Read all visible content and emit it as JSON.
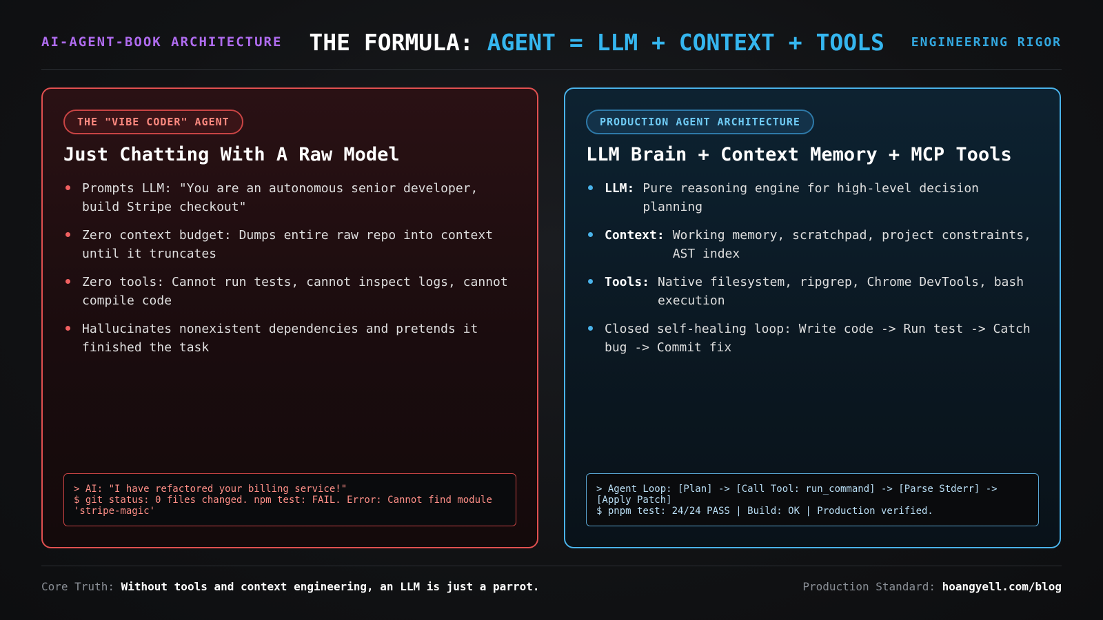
{
  "header": {
    "brand": "AI-AGENT-BOOK ARCHITECTURE",
    "formula_lead": "THE FORMULA:",
    "formula_accent": "AGENT = LLM + CONTEXT + TOOLS",
    "tag": "ENGINEERING RIGOR"
  },
  "left_card": {
    "badge": "THE \"VIBE CODER\" AGENT",
    "title": "Just Chatting With A Raw Model",
    "bullets": [
      "Prompts LLM: \"You are an autonomous senior developer, build Stripe checkout\"",
      "Zero context budget: Dumps entire raw repo into context until it truncates",
      "Zero tools: Cannot run tests, cannot inspect logs, cannot compile code",
      "Hallucinates nonexistent dependencies and pretends it finished the task"
    ],
    "terminal": "> AI: \"I have refactored your billing service!\"\n$ git status: 0 files changed. npm test: FAIL. Error: Cannot find module 'stripe-magic'"
  },
  "right_card": {
    "badge": "PRODUCTION AGENT ARCHITECTURE",
    "title": "LLM Brain + Context Memory + MCP Tools",
    "bullets": [
      {
        "key": "LLM:",
        "text": "Pure reasoning engine for high-level decision planning"
      },
      {
        "key": "Context:",
        "text": "Working memory, scratchpad, project constraints, AST index"
      },
      {
        "key": "Tools:",
        "text": "Native filesystem, ripgrep, Chrome DevTools, bash execution"
      },
      {
        "key": "",
        "text": "Closed self-healing loop: Write code -> Run test -> Catch bug -> Commit fix"
      }
    ],
    "terminal": "> Agent Loop: [Plan] -> [Call Tool: run_command] -> [Parse Stderr] -> [Apply Patch]\n$ pnpm test: 24/24 PASS | Build: OK | Production verified."
  },
  "footer": {
    "left_label": "Core Truth:",
    "left_text": "Without tools and context engineering, an LLM is just a parrot.",
    "right_label": "Production Standard:",
    "right_text": "hoangyell.com/blog"
  },
  "colors": {
    "brand": "#b06cf0",
    "accent_blue": "#35b6ef",
    "danger_red": "#e25050",
    "background": "#111214"
  }
}
